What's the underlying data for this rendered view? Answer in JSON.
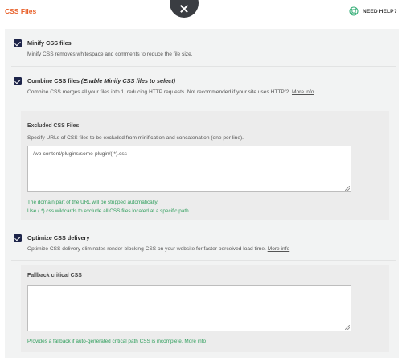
{
  "header": {
    "title": "CSS Files",
    "help_label": "NEED HELP?"
  },
  "options": {
    "minify": {
      "label": "Minify CSS files",
      "description": "Minify CSS removes whitespace and comments to reduce the file size.",
      "checked": true
    },
    "combine": {
      "label": "Combine CSS files",
      "label_hint": "(Enable Minify CSS files to select)",
      "description": "Combine CSS merges all your files into 1, reducing HTTP requests. Not recommended if your site uses HTTP/2.",
      "more_info": "More info",
      "checked": true
    },
    "excluded": {
      "label": "Excluded CSS Files",
      "description": "Specify URLs of CSS files to be excluded from minification and concatenation (one per line).",
      "value": "/wp-content/plugins/some-plugin/(.*).css",
      "note_1": "The domain part of the URL will be stripped automatically.",
      "note_2": "Use (.*).css wildcards to exclude all CSS files located at a specific path."
    },
    "optimize_delivery": {
      "label": "Optimize CSS delivery",
      "description": "Optimize CSS delivery eliminates render-blocking CSS on your website for faster perceived load time.",
      "more_info": "More info",
      "checked": true
    },
    "fallback": {
      "label": "Fallback critical CSS",
      "value": "",
      "note": "Provides a fallback if auto-generated critical path CSS is incomplete.",
      "more_info": "More info"
    }
  },
  "colors": {
    "accent": "#e8612b",
    "checkbox": "#1d2449",
    "note": "#2f9e5c"
  }
}
